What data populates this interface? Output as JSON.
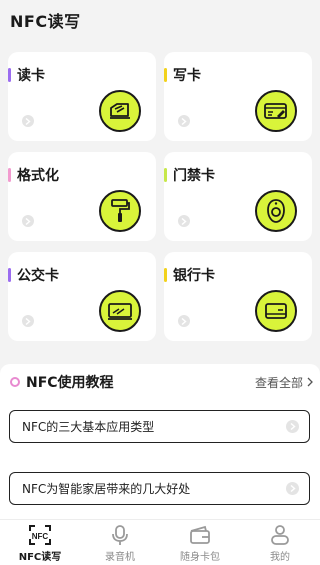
{
  "header": {
    "title": "NFC读写"
  },
  "cards": [
    {
      "label": "读卡",
      "accent": "#9b6cf0",
      "icon": "read-card-icon"
    },
    {
      "label": "写卡",
      "accent": "#f2d21c",
      "icon": "write-card-icon"
    },
    {
      "label": "格式化",
      "accent": "#f29bcf",
      "icon": "paint-roller-icon"
    },
    {
      "label": "门禁卡",
      "accent": "#c7e84a",
      "icon": "access-tag-icon"
    },
    {
      "label": "公交卡",
      "accent": "#9b6cf0",
      "icon": "transit-card-icon"
    },
    {
      "label": "银行卡",
      "accent": "#f2d21c",
      "icon": "bank-card-icon"
    }
  ],
  "tutorial": {
    "title": "NFC使用教程",
    "more": "查看全部",
    "items": [
      "NFC的三大基本应用类型",
      "NFC为智能家居带来的几大好处"
    ]
  },
  "tabs": [
    {
      "label": "NFC读写",
      "icon": "nfc-scan-icon",
      "active": true
    },
    {
      "label": "录音机",
      "icon": "microphone-icon",
      "active": false
    },
    {
      "label": "随身卡包",
      "icon": "wallet-icon",
      "active": false
    },
    {
      "label": "我的",
      "icon": "profile-icon",
      "active": false
    }
  ],
  "colors": {
    "accent_lime": "#d9f43a",
    "background": "#f3f3f3"
  }
}
